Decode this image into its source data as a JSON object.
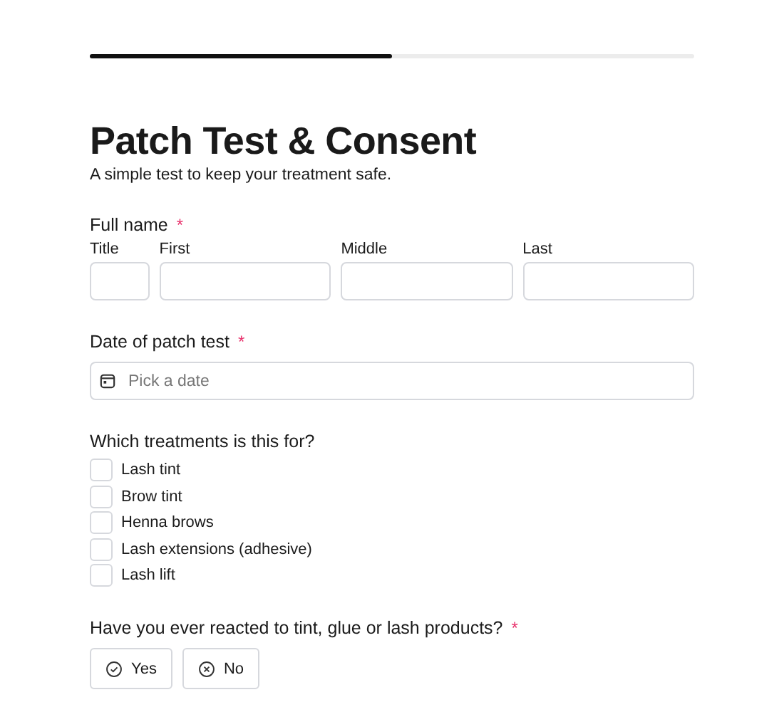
{
  "progress": {
    "level": 0.5
  },
  "title": "Patch Test & Consent",
  "subtitle": "A simple test to keep your treatment safe.",
  "required_mark": "*",
  "full_name": {
    "label": "Full name",
    "required": true,
    "parts": [
      {
        "label": "Title",
        "kind": "short"
      },
      {
        "label": "First",
        "kind": "long"
      },
      {
        "label": "Middle",
        "kind": "long"
      },
      {
        "label": "Last",
        "kind": "long"
      }
    ]
  },
  "date": {
    "label": "Date of patch test",
    "required": true,
    "placeholder": "Pick a date"
  },
  "treatments": {
    "label": "Which treatments is this for?",
    "options": [
      {
        "label": "Lash tint",
        "checked": false
      },
      {
        "label": "Brow tint",
        "checked": false
      },
      {
        "label": "Henna brows",
        "checked": false
      },
      {
        "label": "Lash extensions (adhesive)",
        "checked": false
      },
      {
        "label": "Lash lift",
        "checked": false
      }
    ]
  },
  "reaction": {
    "label": "Have you ever reacted to tint, glue or lash products?",
    "required": true,
    "choices": [
      {
        "label": "Yes",
        "kind": "check",
        "selected": false
      },
      {
        "label": "No",
        "kind": "cross",
        "selected": false
      }
    ]
  }
}
